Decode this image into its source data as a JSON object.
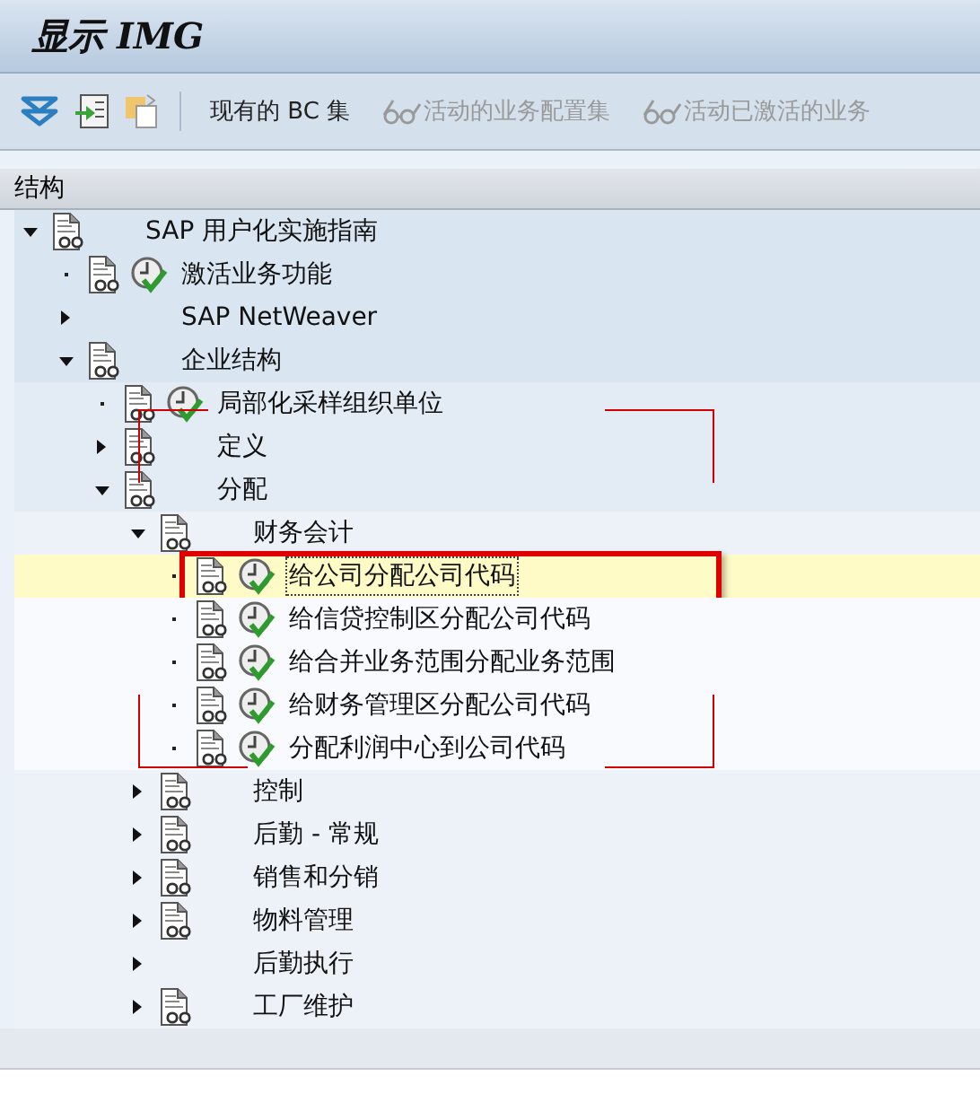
{
  "window": {
    "title": "显示 IMG"
  },
  "toolbar": {
    "buttons": [
      {
        "kind": "expand-all"
      },
      {
        "kind": "import"
      },
      {
        "kind": "copy"
      },
      {
        "kind": "text",
        "label": "现有的 BC 集",
        "disabled": false
      },
      {
        "kind": "glasses",
        "label": "活动的业务配置集",
        "disabled": true
      },
      {
        "kind": "glasses",
        "label": "活动已激活的业务",
        "disabled": true
      }
    ]
  },
  "tree": {
    "header": "结构",
    "nodes": [
      {
        "label": "SAP 用户化实施指南",
        "kind": "branch",
        "expanded": true,
        "doc": true,
        "activity": false,
        "selected": false,
        "children": [
          {
            "label": "激活业务功能",
            "kind": "leaf",
            "doc": true,
            "activity": true,
            "selected": false
          },
          {
            "label": "SAP NetWeaver",
            "kind": "branch",
            "expanded": false,
            "doc": false,
            "activity": false,
            "selected": false
          },
          {
            "label": "企业结构",
            "kind": "branch",
            "expanded": true,
            "doc": true,
            "activity": false,
            "selected": false,
            "children": [
              {
                "label": "局部化采样组织单位",
                "kind": "leaf",
                "doc": true,
                "activity": true,
                "selected": false
              },
              {
                "label": "定义",
                "kind": "branch",
                "expanded": false,
                "doc": true,
                "activity": false,
                "selected": false
              },
              {
                "label": "分配",
                "kind": "branch",
                "expanded": true,
                "doc": true,
                "activity": false,
                "selected": false,
                "children": [
                  {
                    "label": "财务会计",
                    "kind": "branch",
                    "expanded": true,
                    "doc": true,
                    "activity": false,
                    "selected": false,
                    "children": [
                      {
                        "label": "给公司分配公司代码",
                        "kind": "leaf",
                        "doc": true,
                        "activity": true,
                        "selected": true
                      },
                      {
                        "label": "给信贷控制区分配公司代码",
                        "kind": "leaf",
                        "doc": true,
                        "activity": true,
                        "selected": false
                      },
                      {
                        "label": "给合并业务范围分配业务范围",
                        "kind": "leaf",
                        "doc": true,
                        "activity": true,
                        "selected": false
                      },
                      {
                        "label": "给财务管理区分配公司代码",
                        "kind": "leaf",
                        "doc": true,
                        "activity": true,
                        "selected": false
                      },
                      {
                        "label": "分配利润中心到公司代码",
                        "kind": "leaf",
                        "doc": true,
                        "activity": true,
                        "selected": false
                      }
                    ]
                  },
                  {
                    "label": "控制",
                    "kind": "branch",
                    "expanded": false,
                    "doc": true,
                    "activity": false,
                    "selected": false
                  },
                  {
                    "label": "后勤 - 常规",
                    "kind": "branch",
                    "expanded": false,
                    "doc": true,
                    "activity": false,
                    "selected": false
                  },
                  {
                    "label": "销售和分销",
                    "kind": "branch",
                    "expanded": false,
                    "doc": true,
                    "activity": false,
                    "selected": false
                  },
                  {
                    "label": "物料管理",
                    "kind": "branch",
                    "expanded": false,
                    "doc": true,
                    "activity": false,
                    "selected": false
                  },
                  {
                    "label": "后勤执行",
                    "kind": "branch",
                    "expanded": false,
                    "doc": false,
                    "activity": false,
                    "selected": false
                  },
                  {
                    "label": "工厂维护",
                    "kind": "branch",
                    "expanded": false,
                    "doc": true,
                    "activity": false,
                    "selected": false
                  }
                ]
              }
            ]
          }
        ]
      }
    ]
  }
}
